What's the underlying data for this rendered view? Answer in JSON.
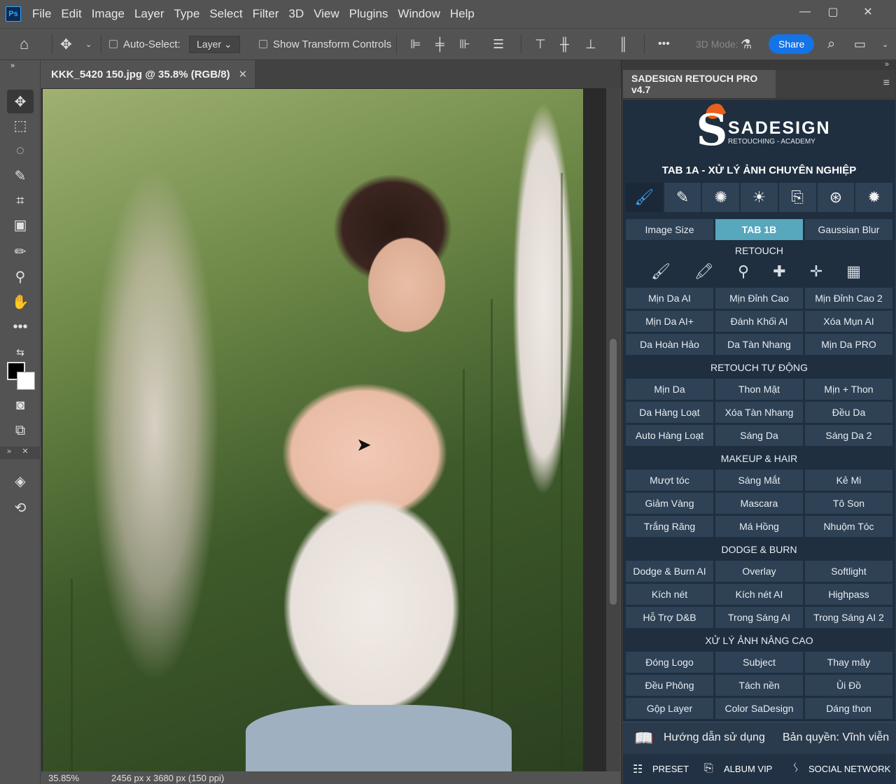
{
  "menubar": {
    "app_logo": "Ps",
    "items": [
      "File",
      "Edit",
      "Image",
      "Layer",
      "Type",
      "Select",
      "Filter",
      "3D",
      "View",
      "Plugins",
      "Window",
      "Help"
    ],
    "window_controls": [
      "—",
      "▢",
      "✕"
    ]
  },
  "options": {
    "auto_select_label": "Auto-Select:",
    "auto_select_value": "Layer",
    "show_transform_label": "Show Transform Controls",
    "more": "•••",
    "mode_3d": "3D Mode:",
    "share": "Share"
  },
  "document": {
    "tab_title": "KKK_5420 150.jpg @ 35.8% (RGB/8)",
    "zoom": "35.85%",
    "dimensions": "2456 px x 3680 px (150 ppi)"
  },
  "panel": {
    "tab_title": "SADESIGN RETOUCH PRO v4.7",
    "brand_name": "SADESIGN",
    "brand_sub": "RETOUCHING - ACADEMY",
    "tab_heading": "TAB 1A - XỬ LÝ ẢNH CHUYÊN NGHIỆP",
    "top_row": [
      "Image Size",
      "TAB 1B",
      "Gaussian Blur"
    ],
    "sections": [
      {
        "title": "RETOUCH",
        "rows": [
          [
            "Mịn Da AI",
            "Mịn Đỉnh Cao",
            "Mịn Đỉnh Cao 2"
          ],
          [
            "Mịn Da AI+",
            "Đánh Khối AI",
            "Xóa Mụn AI"
          ],
          [
            "Da Hoàn Hảo",
            "Da Tàn Nhang",
            "Mịn Da PRO"
          ]
        ]
      },
      {
        "title": "RETOUCH TỰ ĐỘNG",
        "rows": [
          [
            "Mịn Da",
            "Thon Mặt",
            "Mịn + Thon"
          ],
          [
            "Da Hàng Loạt",
            "Xóa Tàn Nhang",
            "Đều Da"
          ],
          [
            "Auto Hàng Loạt",
            "Sáng Da",
            "Sáng Da 2"
          ]
        ]
      },
      {
        "title": "MAKEUP & HAIR",
        "rows": [
          [
            "Mượt tóc",
            "Sáng Mắt",
            "Kẻ Mi"
          ],
          [
            "Giảm Vàng",
            "Mascara",
            "Tô Son"
          ],
          [
            "Trắng Răng",
            "Má Hồng",
            "Nhuộm Tóc"
          ]
        ]
      },
      {
        "title": "DODGE & BURN",
        "rows": [
          [
            "Dodge & Burn AI",
            "Overlay",
            "Softlight"
          ],
          [
            "Kích nét",
            "Kích nét AI",
            "Highpass"
          ],
          [
            "Hỗ Trợ D&B",
            "Trong Sáng AI",
            "Trong Sáng AI 2"
          ]
        ]
      },
      {
        "title": "XỬ LÝ ẢNH NÂNG CAO",
        "rows": [
          [
            "Đóng Logo",
            "Subject",
            "Thay mây"
          ],
          [
            "Đều Phông",
            "Tách nền",
            "Ủi Đồ"
          ],
          [
            "Gộp Layer",
            "Color SaDesign",
            "Dáng thon"
          ]
        ]
      }
    ],
    "guide": "Hướng dẫn sử dụng",
    "license": "Bản quyền: Vĩnh viễn",
    "footer": [
      "PRESET",
      "ALBUM VIP",
      "SOCIAL NETWORK"
    ]
  }
}
